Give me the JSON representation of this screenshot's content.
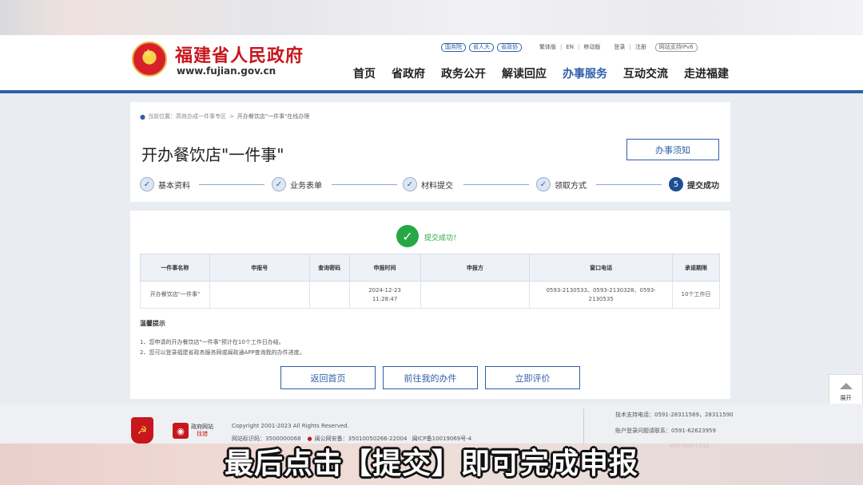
{
  "site": {
    "name": "福建省人民政府",
    "url": "www.fujian.gov.cn"
  },
  "top_links": {
    "pills": [
      "国务院",
      "省人大",
      "省政协"
    ],
    "traditional": "繁体版",
    "english": "EN",
    "mobile": "移动版",
    "login": "登录",
    "register": "注册",
    "ipv6": "网站支持IPv6"
  },
  "nav": {
    "items": [
      "首页",
      "省政府",
      "政务公开",
      "解读回应",
      "办事服务",
      "互动交流",
      "走进福建"
    ],
    "active_index": 4
  },
  "breadcrumb": {
    "label": "当前位置：",
    "parent": "高效办成一件事专区",
    "separator": ">",
    "current": "开办餐饮店\"一件事\"在线办理"
  },
  "page": {
    "title": "开办餐饮店\"一件事\"",
    "notice_button": "办事须知"
  },
  "steps": [
    {
      "num": "✓",
      "label": "基本资料"
    },
    {
      "num": "✓",
      "label": "业务表单"
    },
    {
      "num": "✓",
      "label": "材料提交"
    },
    {
      "num": "✓",
      "label": "领取方式"
    },
    {
      "num": "5",
      "label": "提交成功"
    }
  ],
  "result": {
    "success_text": "提交成功！",
    "headers": [
      "一件事名称",
      "申报号",
      "查询密码",
      "申报时间",
      "申报方",
      "窗口电话",
      "承诺期限"
    ],
    "row": [
      "开办餐饮店\"一件事\"",
      "",
      "",
      "2024-12-23 11:28:47",
      "",
      "0593-2130533、0593-2130328、0593-2130535",
      "10个工作日"
    ]
  },
  "tips": {
    "title": "温馨提示",
    "items": [
      "1、您申请的开办餐饮店\"一件事\"预计在10个工作日办结。",
      "2、您可以登录福建省政务服务网或闽政通APP查询我的办件进度。"
    ]
  },
  "actions": {
    "home": "返回首页",
    "my_items": "前往我的办件",
    "evaluate": "立即评价"
  },
  "float_button": {
    "label": "展开"
  },
  "footer": {
    "badge2_top": "政府网站",
    "badge2_bottom": "找错",
    "copyright": "Copyright 2001-2023 All Rights Reserved.",
    "site_id": "网站标识码：3500000068",
    "police": "闽公网安备：35010050266-22004",
    "icp": "闽ICP备10019069号-4",
    "tech": "技术支持电话：0591-28311589，28311590",
    "account": "账户登录问题请联系：0591-62623959",
    "hotline": "400-666-1331"
  },
  "caption": "最后点击【提交】即可完成申报"
}
